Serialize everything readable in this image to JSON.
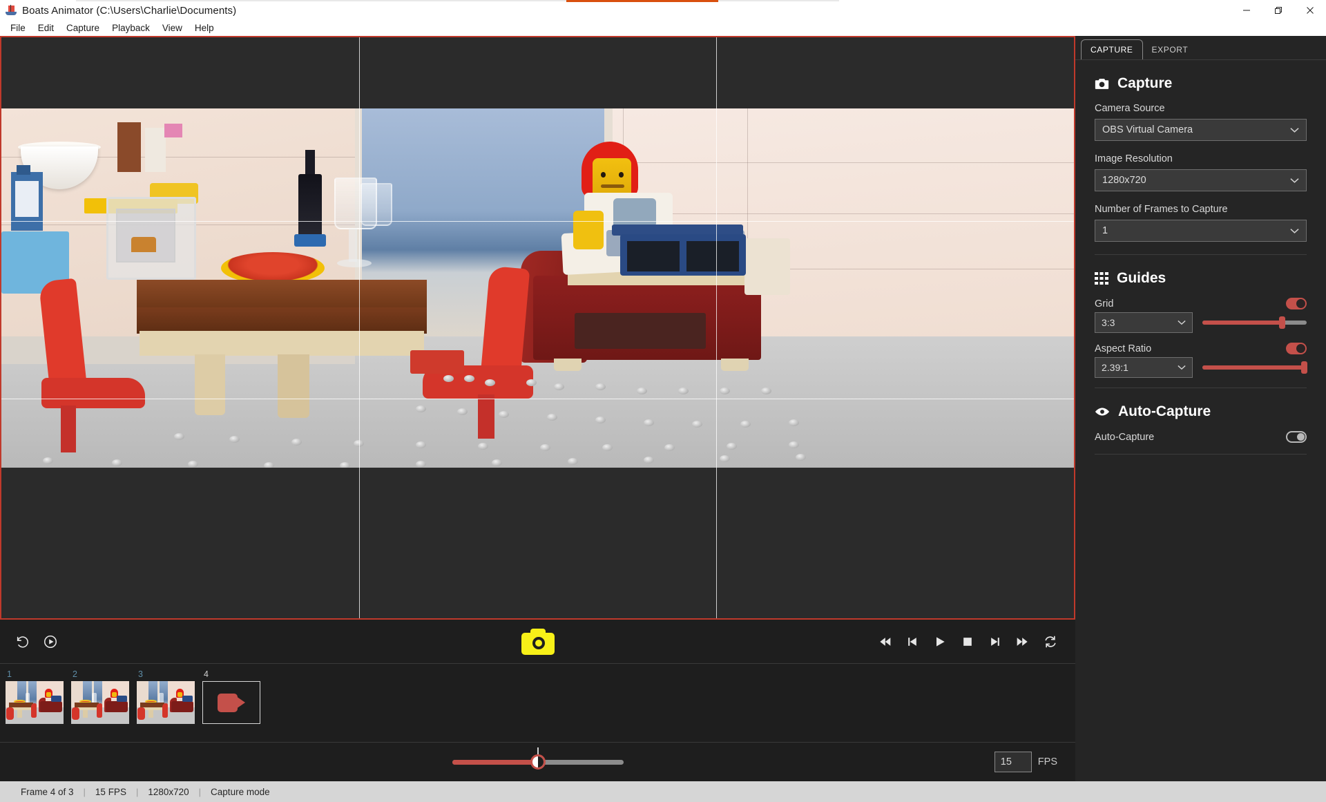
{
  "window": {
    "title": "Boats Animator (C:\\Users\\Charlie\\Documents)",
    "app_icon": "boat-icon",
    "minimize_label": "Minimize",
    "restore_label": "Restore",
    "close_label": "Close"
  },
  "menu": {
    "items": [
      {
        "label": "File"
      },
      {
        "label": "Edit"
      },
      {
        "label": "Capture"
      },
      {
        "label": "Playback"
      },
      {
        "label": "View"
      },
      {
        "label": "Help"
      }
    ]
  },
  "viewport": {
    "border_color": "#c0392b",
    "grid_enabled": true,
    "grid_line_color": "#ffffff",
    "aspect_mask_color": "#2b2b2b"
  },
  "controls": {
    "left": [
      {
        "name": "loop-back-button",
        "icon": "undo-icon"
      },
      {
        "name": "play-circle-button",
        "icon": "play-circle-icon"
      }
    ],
    "capture": {
      "label": "Capture Frame",
      "icon": "camera-icon",
      "color": "#f7f018"
    },
    "playback": [
      {
        "name": "skip-to-start-button",
        "icon": "skip-start-icon"
      },
      {
        "name": "previous-frame-button",
        "icon": "step-back-icon"
      },
      {
        "name": "play-button",
        "icon": "play-icon"
      },
      {
        "name": "stop-button",
        "icon": "stop-icon"
      },
      {
        "name": "next-frame-button",
        "icon": "step-forward-icon"
      },
      {
        "name": "skip-to-end-button",
        "icon": "skip-end-icon"
      },
      {
        "name": "loop-button",
        "icon": "loop-icon"
      }
    ]
  },
  "frames": {
    "items": [
      {
        "number": "1",
        "type": "captured"
      },
      {
        "number": "2",
        "type": "captured"
      },
      {
        "number": "3",
        "type": "captured"
      },
      {
        "number": "4",
        "type": "live",
        "icon": "video-camera-icon"
      }
    ]
  },
  "onion": {
    "value_percent": 50,
    "knob_icon": "half-circle-icon"
  },
  "fps": {
    "value": "15",
    "label": "FPS"
  },
  "sidebar": {
    "tabs": [
      {
        "label": "CAPTURE",
        "active": true
      },
      {
        "label": "EXPORT",
        "active": false
      }
    ],
    "capture_section": {
      "icon": "camera-icon",
      "title": "Capture",
      "camera_source": {
        "label": "Camera Source",
        "value": "OBS Virtual Camera",
        "options": [
          "OBS Virtual Camera"
        ]
      },
      "image_resolution": {
        "label": "Image Resolution",
        "value": "1280x720",
        "options": [
          "1280x720"
        ]
      },
      "frames_to_capture": {
        "label": "Number of Frames to Capture",
        "value": "1",
        "options": [
          "1"
        ]
      }
    },
    "guides_section": {
      "icon": "grid-icon",
      "title": "Guides",
      "grid": {
        "label": "Grid",
        "enabled": true,
        "value": "3:3",
        "options": [
          "3:3"
        ],
        "opacity_percent": 76
      },
      "aspect_ratio": {
        "label": "Aspect Ratio",
        "enabled": true,
        "value": "2.39:1",
        "options": [
          "2.39:1"
        ],
        "opacity_percent": 100
      }
    },
    "autocapture_section": {
      "icon": "eye-icon",
      "title": "Auto-Capture",
      "toggle": {
        "label": "Auto-Capture",
        "enabled": false
      }
    },
    "accent_color": "#c4504a"
  },
  "statusbar": {
    "frame": "Frame 4 of 3",
    "fps": "15 FPS",
    "resolution": "1280x720",
    "mode": "Capture mode",
    "separator": "|"
  }
}
